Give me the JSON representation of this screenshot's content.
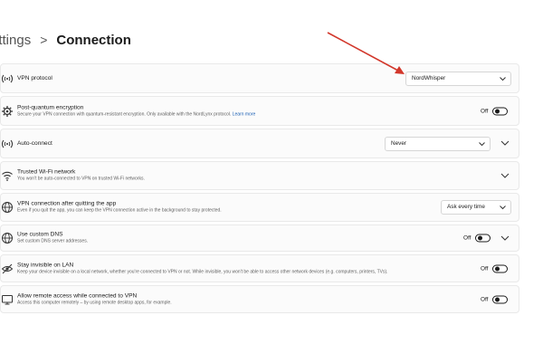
{
  "breadcrumb": {
    "parent": "ettings",
    "separator": ">",
    "current": "Connection"
  },
  "settings": [
    {
      "title": "VPN protocol",
      "control": "dropdown",
      "value": "NordWhisper",
      "icon": "vpn-signal-icon"
    },
    {
      "title": "Post-quantum encryption",
      "description": "Secure your VPN connection with quantum-resistant encryption. Only available with the NordLynx protocol.",
      "link": "Learn more",
      "control": "toggle",
      "toggle_label": "Off",
      "icon": "gear-icon"
    },
    {
      "title": "Auto-connect",
      "control": "dropdown",
      "value": "Never",
      "icon": "vpn-signal-icon"
    },
    {
      "title": "Trusted Wi-Fi network",
      "description": "You won't be auto-connected to VPN on trusted Wi-Fi networks.",
      "control": "chevron",
      "icon": "wifi-icon"
    },
    {
      "title": "VPN connection after quitting the app",
      "description": "Even if you quit the app, you can keep the VPN connection active in the background to stay protected.",
      "control": "dropdown",
      "value": "Ask every time",
      "icon": "globe-icon"
    },
    {
      "title": "Use custom DNS",
      "description": "Set custom DNS server addresses.",
      "control": "toggle",
      "toggle_label": "Off",
      "icon": "dns-icon"
    },
    {
      "title": "Stay invisible on LAN",
      "description": "Keep your device invisible on a local network, whether you're connected to VPN or not. While invisible, you won't be able to access other network devices (e.g. computers, printers, TVs).",
      "control": "toggle",
      "toggle_label": "Off",
      "icon": "invisible-icon"
    },
    {
      "title": "Allow remote access while connected to VPN",
      "description": "Access this computer remotely – by using remote desktop apps, for example.",
      "control": "toggle",
      "toggle_label": "Off",
      "icon": "remote-desktop-icon"
    }
  ],
  "annotation": {
    "arrow_color": "#d2372b"
  }
}
